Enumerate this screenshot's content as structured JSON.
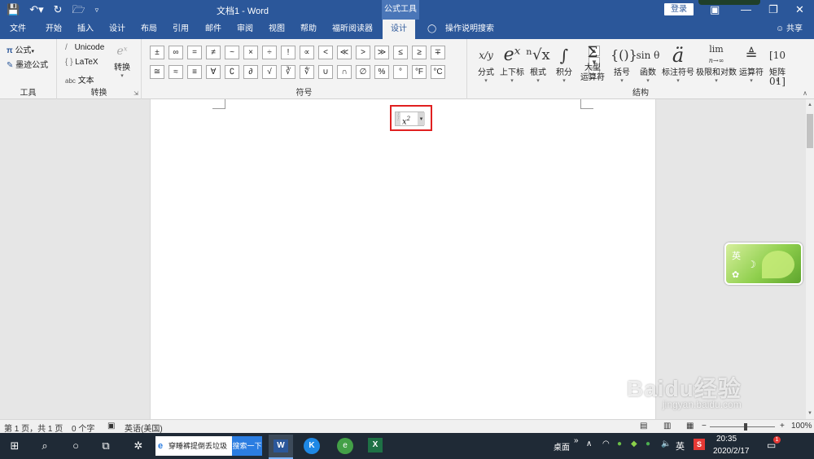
{
  "titlebar": {
    "doc_title": "文档1  -  Word",
    "context_header": "公式工具",
    "login_label": "登录"
  },
  "tabs": {
    "file": "文件",
    "home": "开始",
    "insert": "插入",
    "design": "设计",
    "layout": "布局",
    "references": "引用",
    "mailings": "邮件",
    "review": "审阅",
    "view": "视图",
    "help": "帮助",
    "foxit": "福昕阅读器",
    "eq_design": "设计",
    "tell_me": "操作说明搜索",
    "share": "共享"
  },
  "ribbon": {
    "tools": {
      "equation": "公式",
      "ink_equation": "墨迹公式",
      "label": "工具"
    },
    "conversions": {
      "unicode": "Unicode",
      "latex": "LaTeX",
      "abc_prefix": "abc",
      "text": "文本",
      "convert": "转换",
      "label": "转换"
    },
    "symbols": {
      "label": "符号",
      "row1": [
        "±",
        "∞",
        "=",
        "≠",
        "~",
        "×",
        "÷",
        "!",
        "∝",
        "<",
        "≪",
        ">",
        "≫",
        "≤",
        "≥",
        "∓"
      ],
      "row2": [
        "≅",
        "≈",
        "≡",
        "∀",
        "∁",
        "∂",
        "√",
        "∛",
        "∜",
        "∪",
        "∩",
        "∅",
        "%",
        "°",
        "°F",
        "°C"
      ]
    },
    "structures": {
      "label": "结构",
      "fraction": "分式",
      "script": "上下标",
      "radical": "根式",
      "integral": "积分",
      "large_operator": "大型\n运算符",
      "large_operator_l1": "大型",
      "large_operator_l2": "运算符",
      "bracket": "括号",
      "function": "函数",
      "accent": "标注符号",
      "limit_log": "极限和对数",
      "operator": "运算符",
      "matrix": "矩阵",
      "glyph_function": "sin θ",
      "glyph_limit": "lim",
      "glyph_limit_sub": "n→∞"
    }
  },
  "equation": {
    "content": "x²",
    "base": "x",
    "sup": "2"
  },
  "statusbar": {
    "page": "第 1 页，共 1 页",
    "words": "0 个字",
    "language": "英语(美国)",
    "zoom": "100%"
  },
  "ime": {
    "lang": "英"
  },
  "taskbar": {
    "search_text": "穿睡裤提倒丢垃圾",
    "search_button": "搜索一下",
    "desktop": "桌面",
    "ime_lang": "英",
    "time": "20:35",
    "date": "2020/2/17",
    "notification_count": "1"
  },
  "watermark": {
    "brand": "Baidu经验",
    "url": "jingyan.baidu.com"
  }
}
